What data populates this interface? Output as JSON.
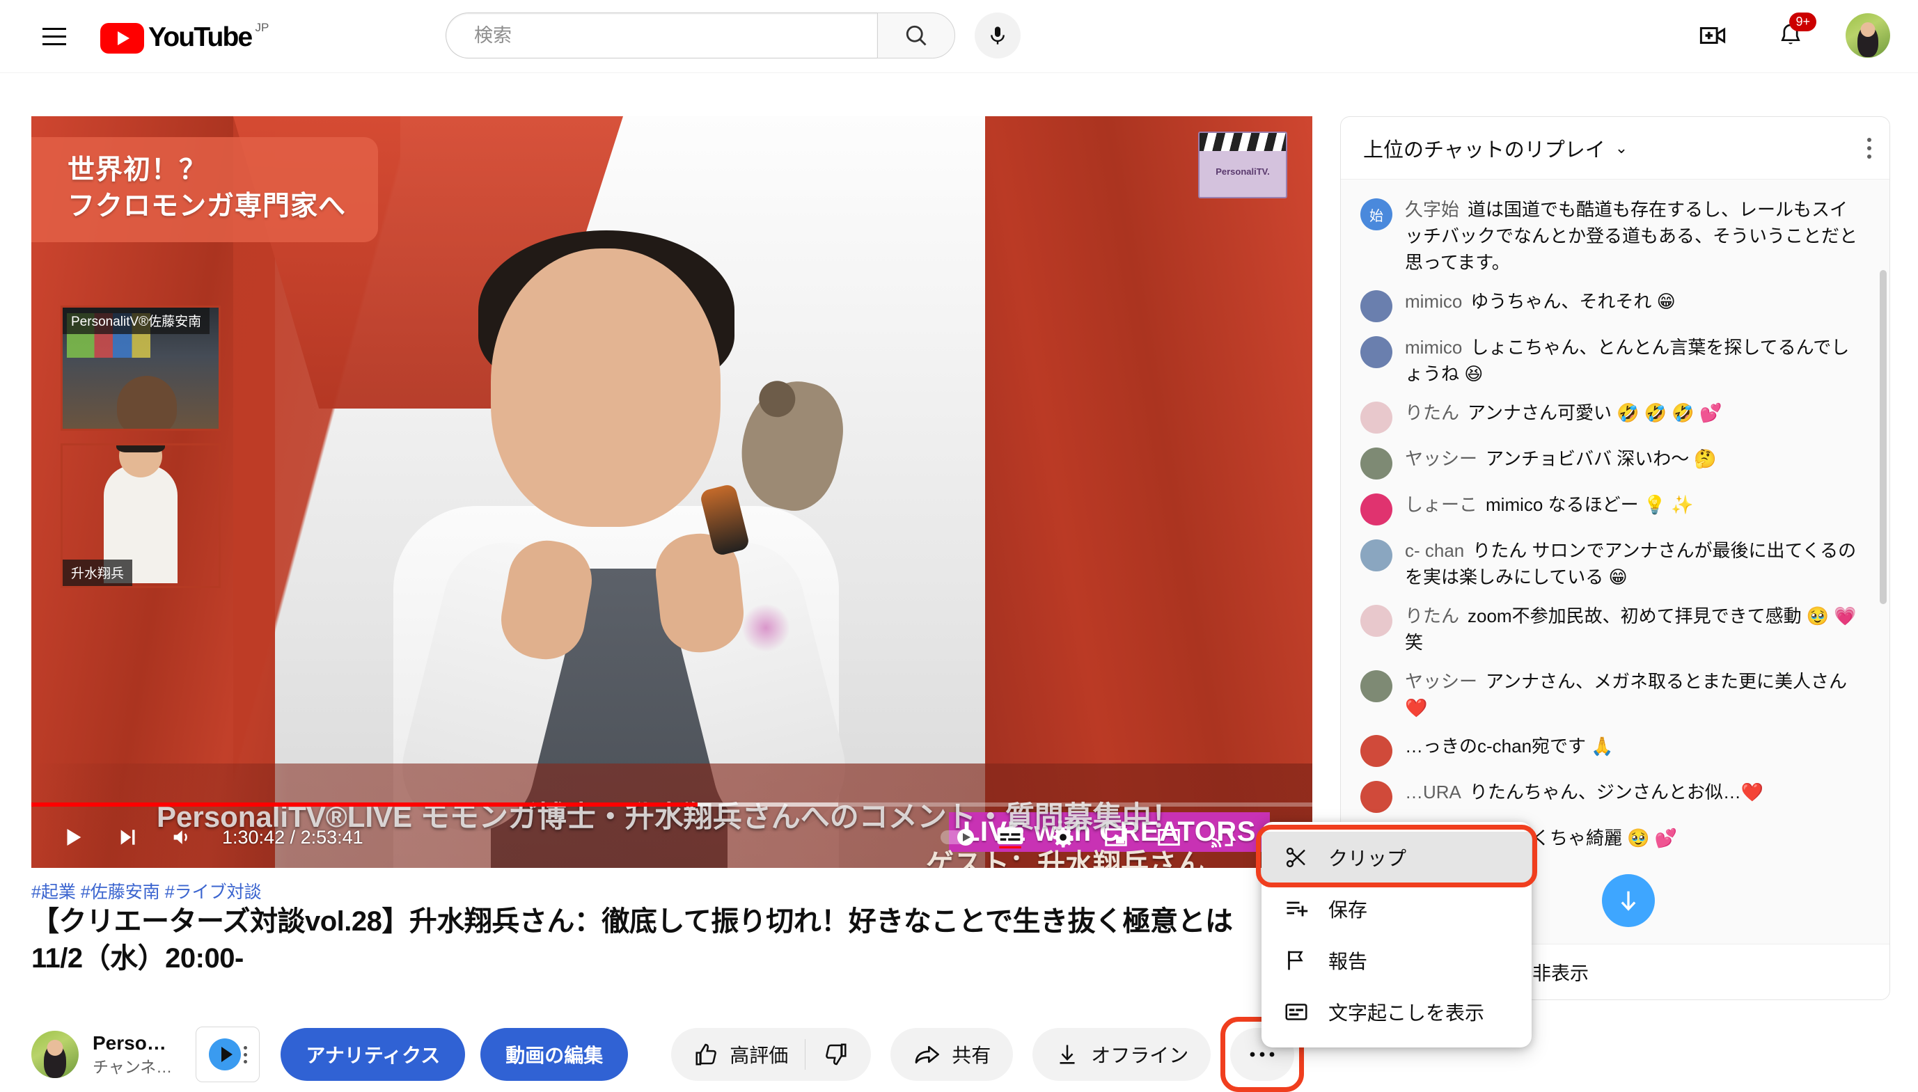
{
  "header": {
    "menu_icon": "hamburger-icon",
    "logo_text": "YouTube",
    "country_code": "JP",
    "search": {
      "placeholder": "検索",
      "value": "",
      "search_icon": "search-icon",
      "mic_icon": "microphone-icon"
    },
    "create_icon": "create-video-icon",
    "notifications_icon": "bell-icon",
    "notifications_badge": "9+",
    "avatar_icon": "account-avatar"
  },
  "player": {
    "banner_line1": "世界初！？",
    "banner_line2": "フクロモンガ専門家へ",
    "pip_1_label": "PersonalitV®佐藤安南",
    "pip_2_label": "升水翔兵",
    "clapper_label": "PersonaliTV.",
    "live_tag": "LIVE with CREATORS",
    "guest_text": "ゲスト：升水翔兵さん",
    "ticker_text": "PersonaliTV®LIVE モモンガ博士・升水翔兵さんへのコメント・質問募集中！",
    "current_time": "1:30:42",
    "total_time": "2:53:41",
    "time_display": "1:30:42 / 2:53:41",
    "progress_percent": 52,
    "buffered_percent": 63,
    "controls": {
      "play_icon": "play-icon",
      "next_icon": "next-video-icon",
      "volume_icon": "volume-icon",
      "autoplay_icon": "autoplay-toggle-icon",
      "subtitles_icon": "subtitles-icon",
      "settings_icon": "settings-gear-icon",
      "miniplayer_icon": "miniplayer-icon",
      "theater_icon": "theater-mode-icon",
      "cast_icon": "cast-icon",
      "fullscreen_icon": "fullscreen-icon"
    }
  },
  "video": {
    "hashtags": "#起業 #佐藤安南 #ライブ対談",
    "title_line1": "【クリエーターズ対談vol.28】升水翔兵さん：徹底して振り切れ！好きなことで生き抜く極意とは",
    "title_line2": "11/2（水）20:00-"
  },
  "channel": {
    "name": "Perso…",
    "subscribers": "チャンネ…",
    "avatar_icon": "channel-avatar",
    "vidiq_icon": "vidiq-extension-icon"
  },
  "actions": {
    "analytics_label": "アナリティクス",
    "edit_video_label": "動画の編集",
    "like_label": "高評価",
    "like_icon": "thumbs-up-icon",
    "dislike_icon": "thumbs-down-icon",
    "share_label": "共有",
    "share_icon": "share-arrow-icon",
    "offline_label": "オフライン",
    "offline_icon": "download-icon",
    "more_icon": "more-horizontal-icon"
  },
  "context_menu": {
    "items": [
      {
        "label": "クリップ",
        "icon": "scissors-icon",
        "active": true
      },
      {
        "label": "保存",
        "icon": "save-to-playlist-icon",
        "active": false
      },
      {
        "label": "報告",
        "icon": "flag-icon",
        "active": false
      },
      {
        "label": "文字起こしを表示",
        "icon": "transcript-icon",
        "active": false
      }
    ]
  },
  "chat": {
    "title": "上位のチャットのリプレイ",
    "caret_icon": "chevron-down-icon",
    "kebab_icon": "kebab-menu-icon",
    "jump_icon": "scroll-to-bottom-icon",
    "hide_replay_label": "…ットのリプレイを非表示",
    "messages": [
      {
        "author": "久字始",
        "initial": "始",
        "avatar_color": "#4a89dc",
        "text": "道は国道でも酷道も存在するし、レールもスイッチバックでなんとか登る道もある、そういうことだと思ってます。"
      },
      {
        "author": "mimico",
        "initial": "",
        "avatar_color": "#6a7fae",
        "text": "ゆうちゃん、それそれ 😁"
      },
      {
        "author": "mimico",
        "initial": "",
        "avatar_color": "#6a7fae",
        "text": "しょこちゃん、とんとん言葉を探してるんでしょうね 😆"
      },
      {
        "author": "りたん",
        "initial": "",
        "avatar_color": "#e8c8cc",
        "text": "アンナさん可愛い 🤣 🤣 🤣 💕"
      },
      {
        "author": "ヤッシー",
        "initial": "",
        "avatar_color": "#7e8a74",
        "text": "アンチョビババ 深いわ〜 🤔"
      },
      {
        "author": "しょーこ",
        "initial": "",
        "avatar_color": "#e0336f",
        "text": "mimico なるほどー 💡 ✨"
      },
      {
        "author": "c- chan",
        "initial": "",
        "avatar_color": "#8aa6c0",
        "text": "りたん サロンでアンナさんが最後に出てくるのを実は楽しみにしている 😁"
      },
      {
        "author": "りたん",
        "initial": "",
        "avatar_color": "#e8c8cc",
        "text": "zoom不参加民故、初めて拝見できて感動 🥹 💗 笑"
      },
      {
        "author": "ヤッシー",
        "initial": "",
        "avatar_color": "#7e8a74",
        "text": "アンナさん、メガネ取るとまた更に美人さん ❤️"
      },
      {
        "author": "",
        "initial": "",
        "avatar_color": "#d04a3a",
        "text": "…っきのc-chan宛です 🙏"
      },
      {
        "author": "…URA",
        "initial": "",
        "avatar_color": "#d04a3a",
        "text": "りたんちゃん、ジンさんとお似…❤️"
      },
      {
        "author": "",
        "initial": "",
        "avatar_color": "#cfcfcf",
        "text": "…凪とかも…ゃくちゃ綺麗 🥹 💕"
      }
    ]
  },
  "colors": {
    "brand_red": "#ff0000",
    "highlight_orange": "#f03e1e",
    "accent_blue": "#3062d4",
    "link_blue": "#3a64cf",
    "jump_blue": "#3ea6ff"
  }
}
